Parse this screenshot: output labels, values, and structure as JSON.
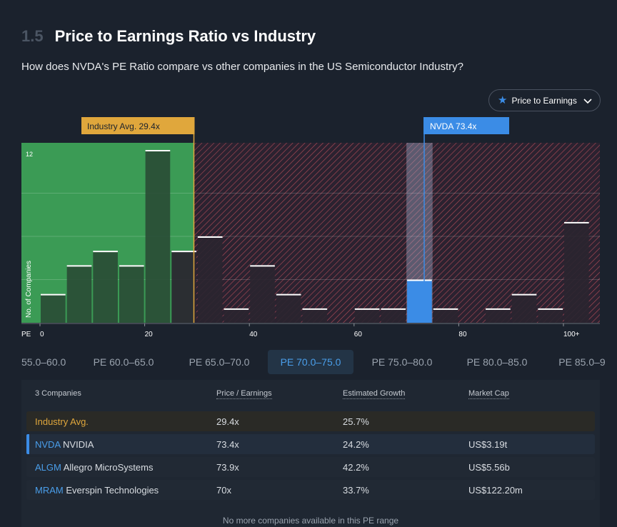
{
  "header": {
    "section_number": "1.5",
    "title": "Price to Earnings Ratio vs Industry",
    "question": "How does NVDA's PE Ratio compare vs other companies in the US Semiconductor Industry?"
  },
  "metric_selector": {
    "label": "Price to Earnings",
    "icon": "star-icon"
  },
  "colors": {
    "green_zone": "#3fa95a",
    "red_hatch": "#c0505a",
    "industry_marker": "#e0a73c",
    "company_marker": "#3b8ce6",
    "background": "#1b222d"
  },
  "chart_data": {
    "type": "bar",
    "bin_width": 5,
    "x_axis_label": "PE",
    "y_axis_label": "No. of Companies",
    "y_max_label": "12",
    "ylim": [
      0,
      12
    ],
    "xlim": [
      0,
      105
    ],
    "x_ticks": [
      {
        "value": 0,
        "label": "0"
      },
      {
        "value": 20,
        "label": "20"
      },
      {
        "value": 40,
        "label": "40"
      },
      {
        "value": 60,
        "label": "60"
      },
      {
        "value": 80,
        "label": "80"
      },
      {
        "value": 100,
        "label": "100+"
      }
    ],
    "bins": [
      {
        "start": 0,
        "count": 2
      },
      {
        "start": 5,
        "count": 4
      },
      {
        "start": 10,
        "count": 5
      },
      {
        "start": 15,
        "count": 4
      },
      {
        "start": 20,
        "count": 12
      },
      {
        "start": 25,
        "count": 5
      },
      {
        "start": 30,
        "count": 6
      },
      {
        "start": 35,
        "count": 1
      },
      {
        "start": 40,
        "count": 4
      },
      {
        "start": 45,
        "count": 2
      },
      {
        "start": 50,
        "count": 1
      },
      {
        "start": 55,
        "count": 0
      },
      {
        "start": 60,
        "count": 1
      },
      {
        "start": 65,
        "count": 1
      },
      {
        "start": 70,
        "count": 3
      },
      {
        "start": 75,
        "count": 1
      },
      {
        "start": 80,
        "count": 0
      },
      {
        "start": 85,
        "count": 1
      },
      {
        "start": 90,
        "count": 2
      },
      {
        "start": 95,
        "count": 1
      },
      {
        "start": 100,
        "count": 7
      }
    ],
    "highlight_bin_start": 70,
    "industry_avg": {
      "value": 29.4,
      "label": "Industry Avg. 29.4x"
    },
    "company": {
      "value": 73.4,
      "label": "NVDA 73.4x"
    }
  },
  "range_tabs": [
    {
      "label": "55.0–60.0",
      "active": false
    },
    {
      "label": "PE 60.0–65.0",
      "active": false
    },
    {
      "label": "PE 65.0–70.0",
      "active": false
    },
    {
      "label": "PE 70.0–75.0",
      "active": true
    },
    {
      "label": "PE 75.0–80.0",
      "active": false
    },
    {
      "label": "PE 80.0–85.0",
      "active": false
    },
    {
      "label": "PE 85.0–9",
      "active": false
    }
  ],
  "table": {
    "headers": {
      "count": "3 Companies",
      "pe": "Price / Earnings",
      "growth": "Estimated Growth",
      "cap": "Market Cap"
    },
    "industry_row": {
      "name": "Industry Avg.",
      "pe": "29.4x",
      "growth": "25.7%",
      "cap": ""
    },
    "rows": [
      {
        "ticker": "NVDA",
        "name": "NVIDIA",
        "pe": "73.4x",
        "growth": "24.2%",
        "cap": "US$3.19t"
      },
      {
        "ticker": "ALGM",
        "name": "Allegro MicroSystems",
        "pe": "73.9x",
        "growth": "42.2%",
        "cap": "US$5.56b"
      },
      {
        "ticker": "MRAM",
        "name": "Everspin Technologies",
        "pe": "70x",
        "growth": "33.7%",
        "cap": "US$122.20m"
      }
    ],
    "footer": "No more companies available in this PE range"
  }
}
